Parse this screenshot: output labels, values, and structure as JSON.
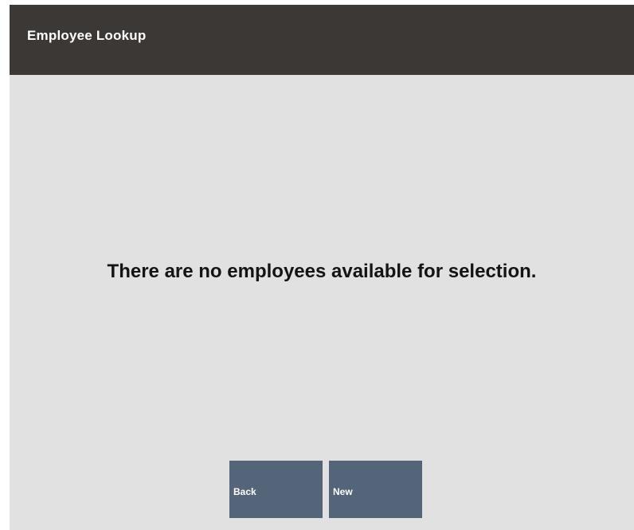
{
  "header": {
    "title": "Employee Lookup"
  },
  "main": {
    "message": "There are no employees available for selection."
  },
  "buttons": {
    "back_label": "Back",
    "new_label": "New"
  },
  "colors": {
    "header_bg": "#3b3835",
    "content_bg": "#e1e1e1",
    "button_bg": "#546479"
  }
}
